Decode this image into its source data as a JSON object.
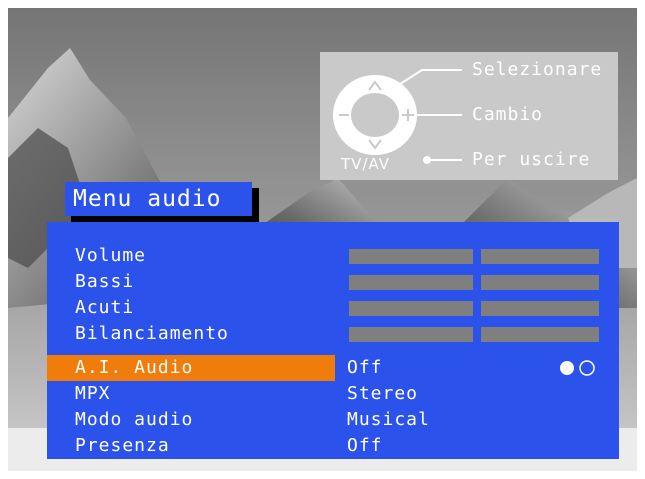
{
  "remote": {
    "select_label": "Selezionare",
    "change_label": "Cambio",
    "exit_label": "Per uscire",
    "tvav_label": "TV/AV"
  },
  "menu": {
    "title": "Menu audio",
    "rows": [
      {
        "label": "Volume",
        "control": "slider",
        "level": 0.5
      },
      {
        "label": "Bassi",
        "control": "slider",
        "level": 0.5
      },
      {
        "label": "Acuti",
        "control": "slider",
        "level": 0.5
      },
      {
        "label": "Bilanciamento",
        "control": "slider",
        "level": 0.5
      },
      {
        "label": "A.I. Audio",
        "value": "Off",
        "selected": true
      },
      {
        "label": "MPX",
        "value": "Stereo"
      },
      {
        "label": "Modo audio",
        "value": "Musical"
      },
      {
        "label": "Presenza",
        "value": "Off"
      }
    ]
  },
  "colors": {
    "menu_bg": "#2b52ea",
    "highlight": "#f07c0c",
    "slider": "#7f7f7f",
    "remote_panel": "#c9c9c9"
  },
  "icons": [
    "up-arrow-icon",
    "down-arrow-icon",
    "minus-icon",
    "plus-icon",
    "exit-dot-icon",
    "toggle-dots-icon"
  ]
}
